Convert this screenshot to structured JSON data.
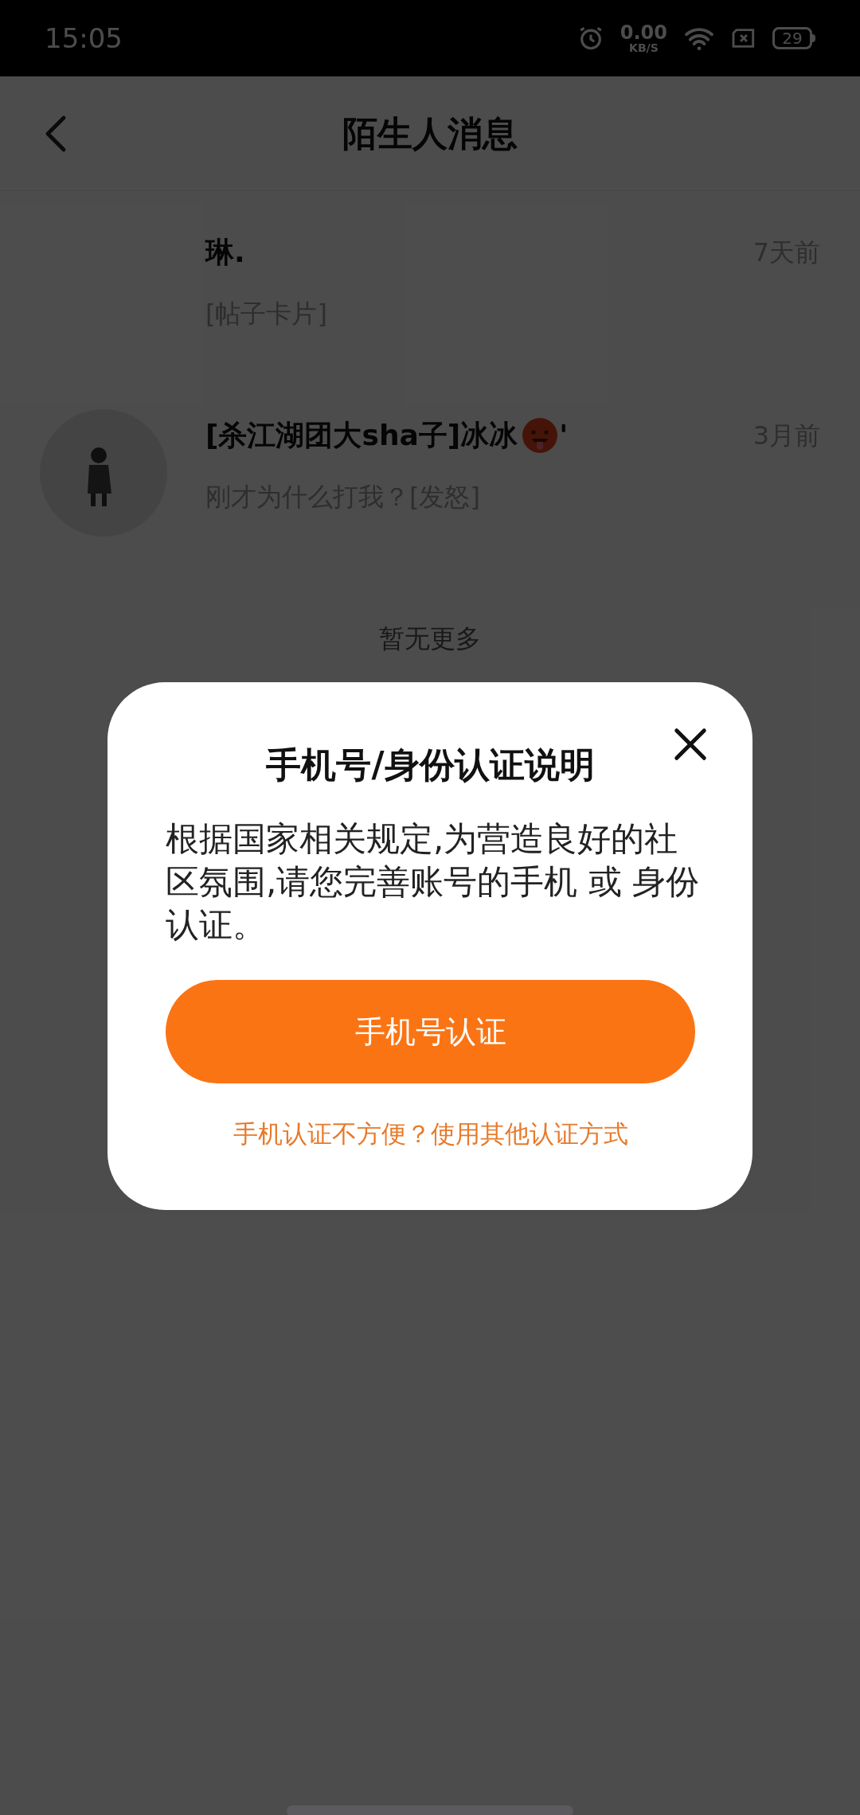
{
  "status_bar": {
    "time": "15:05",
    "speed_value": "0.00",
    "speed_unit": "KB/S",
    "battery": "29"
  },
  "header": {
    "title": "陌生人消息"
  },
  "messages": [
    {
      "name": "琳.",
      "has_avatar": false,
      "emoji": false,
      "time": "7天前",
      "preview": "[帖子卡片]"
    },
    {
      "name": "[杀江湖团大sha子]冰冰",
      "has_avatar": true,
      "emoji": true,
      "name_suffix": "'",
      "time": "3月前",
      "preview": "刚才为什么打我？[发怒]"
    }
  ],
  "list_footer": "暂无更多",
  "dialog": {
    "title": "手机号/身份认证说明",
    "body": "根据国家相关规定,为营造良好的社区氛围,请您完善账号的手机 或 身份认证。",
    "button": "手机号认证",
    "link": "手机认证不方便？使用其他认证方式"
  }
}
